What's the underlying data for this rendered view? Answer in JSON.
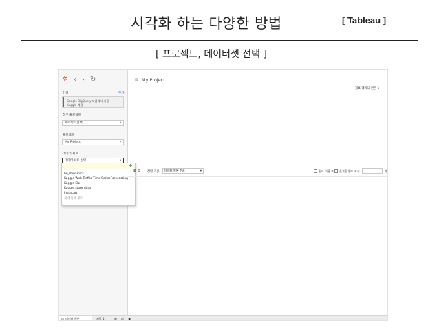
{
  "slide": {
    "title": "시각화 하는 다양한 방법",
    "tag": "[ Tableau ]",
    "subtitle": "[ 프로젝트, 데이터셋 선택 ]"
  },
  "app": {
    "toolbar": {
      "back": "‹",
      "forward": "›",
      "refresh": "↻"
    },
    "connections_label": "연결",
    "add_label": "추가",
    "connection_lines": [
      "Google BigQuery 다음에서 사용",
      "Kaggle 계정"
    ],
    "billing_project_label": "청구 프로젝트",
    "billing_project_value": "프로젝트 선택",
    "project_label": "프로젝트",
    "project_value": "My Project",
    "dataset_label": "데이터 세트",
    "dataset_value": "데이터 세트 선택",
    "dataset_options": [
      "bq_dynamics",
      "Kaggle Web Traffic Time SeriesForecasting",
      "Kaggle Elo",
      "Kaggle store data",
      "Instacart",
      "새 데이터 세트"
    ],
    "canvas_title": "My Project",
    "canvas_right_label": "필요 데이터 원본 1",
    "toolrow_label": "정렬 기준",
    "toolrow_select": "데이터 원본 순서",
    "check1": "필드 이름 표시",
    "check2": "숨겨진 필드 표시",
    "num_suffix": "행",
    "bottom_tabs": [
      "데이터 원본",
      "시트 1"
    ]
  }
}
